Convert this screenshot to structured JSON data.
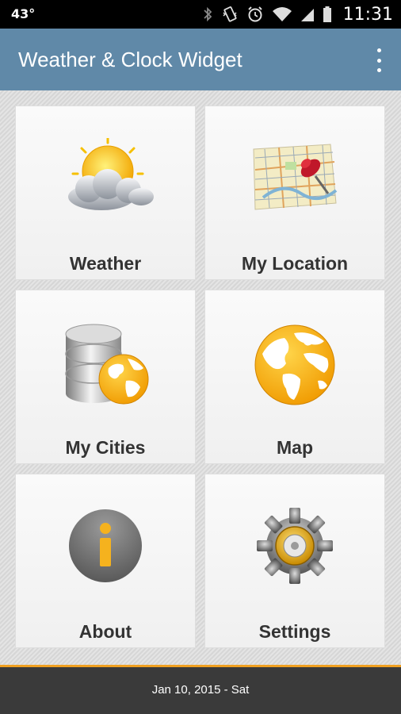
{
  "status_bar": {
    "temperature": "43°",
    "time": "11:31",
    "icons": [
      "bluetooth-icon",
      "vibrate-icon",
      "alarm-icon",
      "wifi-icon",
      "signal-icon",
      "battery-icon"
    ]
  },
  "app_bar": {
    "title": "Weather & Clock Widget",
    "overflow_icon": "more-vert-icon"
  },
  "tiles": [
    {
      "label": "Weather",
      "icon": "weather-sun-cloud-icon"
    },
    {
      "label": "My Location",
      "icon": "map-pin-icon"
    },
    {
      "label": "My Cities",
      "icon": "database-globe-icon"
    },
    {
      "label": "Map",
      "icon": "globe-icon"
    },
    {
      "label": "About",
      "icon": "info-icon"
    },
    {
      "label": "Settings",
      "icon": "gear-icon"
    }
  ],
  "footer": {
    "date": "Jan 10, 2015 - Sat"
  },
  "colors": {
    "app_bar": "#6089a8",
    "accent": "#f0a020",
    "footer": "#3a3a3a"
  }
}
